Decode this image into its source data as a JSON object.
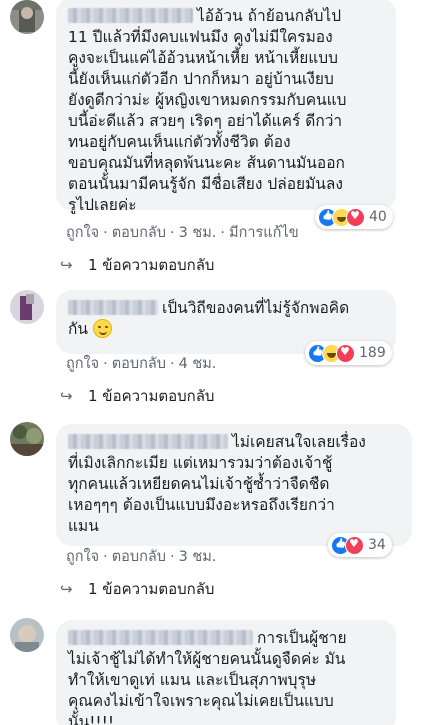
{
  "comments": [
    {
      "text": "ไอ้อ้วน ถ้าย้อนกลับไป\n11 ปีแล้วที่มึงคบแฟนมึง คูงไม่มีใครมอง\nคูงจะเป็นแค่ไอ้อ้วนหน้าเหี้ย หน้าเหี้ยแบบ\nนี้ยังเห็นแก่ตัวอีก ปากก็หมา อยู่บ้านเงียบ\nยังดูดีกว่าม่ะ ผู้หญิงเขาหมดกรรมกับคนแบ\nบนี้อ่ะดีแล้ว สวยๆ เริดๆ อย่าได้แคร์ ดีกว่า\nทนอยู่กับคนเห็นแก่ตัวทั้งชีวิต ต้อง\nขอบคุณมันที่หลุดพ้นนะคะ ส้นดานมันออก\nตอนนั้นมามีคนรู้จัก มีชื่อเสียง ปล่อยมันลง\nรูไปเลยค่ะ",
      "reaction_count": "40",
      "reactions": [
        "like",
        "haha",
        "love"
      ],
      "like_label": "ถูกใจ",
      "reply_label": "ตอบกลับ",
      "time": "3 ชม.",
      "extra": "มีการแก้ไข",
      "replies_label": "1 ข้อความตอบกลับ"
    },
    {
      "text": "เป็นวิถีของคนที่ไม่รู้จักพอคิด\nกัน",
      "reaction_count": "189",
      "reactions": [
        "like",
        "haha",
        "love"
      ],
      "like_label": "ถูกใจ",
      "reply_label": "ตอบกลับ",
      "time": "4 ชม.",
      "replies_label": "1 ข้อความตอบกลับ"
    },
    {
      "text": "ไม่เคยสนใจเลยเรื่อง\nที่เมิงเลิกกะเมีย แต่เหมารวมว่าต้องเจ้าชู้\nทุกคนแล้วเหยียดคนไม่เจ้าชู้ซ้ำว่าจืดชืด\nเหอๆๆๆ ต้องเป็นแบบมึงอะหรอถึงเรียกว่า\nแมน",
      "reaction_count": "34",
      "reactions": [
        "like",
        "love"
      ],
      "like_label": "ถูกใจ",
      "reply_label": "ตอบกลับ",
      "time": "3 ชม.",
      "replies_label": "1 ข้อความตอบกลับ"
    },
    {
      "text": "การเป็นผู้ชาย\nไม่เจ้าชู้ไม่ได้ทำให้ผู้ชายคนนั้นดูจืดค่ะ มัน\nทำให้เขาดูเท่ แมน และเป็นสุภาพบุรุษ\nคุณคงไม่เข้าใจเพราะคุณไม่เคยเป็นแบบ\nนั้น!!!!"
    }
  ],
  "colors": {
    "bubble": "#f2f3f5",
    "meta": "#606770",
    "like": "#1877f2",
    "love": "#f33e58"
  }
}
